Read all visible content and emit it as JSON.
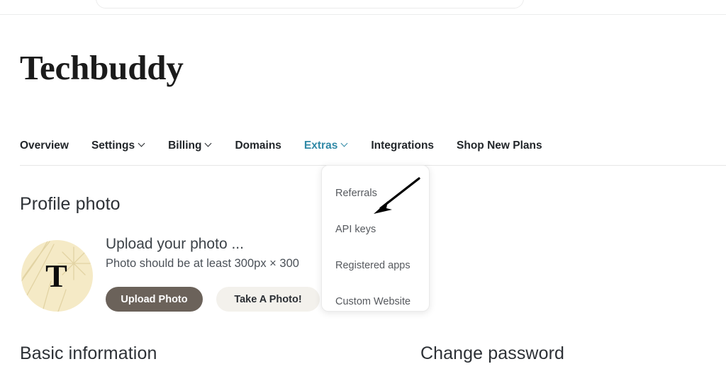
{
  "brand": {
    "title": "Techbuddy"
  },
  "nav": {
    "items": [
      {
        "label": "Overview",
        "has_caret": false,
        "active": false
      },
      {
        "label": "Settings",
        "has_caret": true,
        "active": false
      },
      {
        "label": "Billing",
        "has_caret": true,
        "active": false
      },
      {
        "label": "Domains",
        "has_caret": false,
        "active": false
      },
      {
        "label": "Extras",
        "has_caret": true,
        "active": true
      },
      {
        "label": "Integrations",
        "has_caret": false,
        "active": false
      },
      {
        "label": "Shop New Plans",
        "has_caret": false,
        "active": false
      }
    ],
    "active_color": "#3089a6",
    "default_color": "#22262a"
  },
  "dropdown": {
    "owner": "Extras",
    "items": [
      {
        "label": "Referrals"
      },
      {
        "label": "API keys"
      },
      {
        "label": "Registered apps"
      },
      {
        "label": "Custom Website"
      }
    ]
  },
  "annotation": {
    "type": "arrow",
    "points_to": "API keys",
    "color": "#000000"
  },
  "profile": {
    "heading": "Profile photo",
    "avatar": {
      "initial": "T",
      "background_color": "#f5eac6",
      "letter_color": "#0d0d0d"
    },
    "upload_title": "Upload your photo ...",
    "upload_hint": "Photo should be at least 300px × 300",
    "upload_button": "Upload Photo",
    "take_photo_button": "Take A Photo!",
    "upload_button_color": "#6b625a",
    "take_photo_button_color": "#f3f1ec"
  },
  "sections": {
    "basic_information": "Basic information",
    "change_password": "Change password"
  }
}
